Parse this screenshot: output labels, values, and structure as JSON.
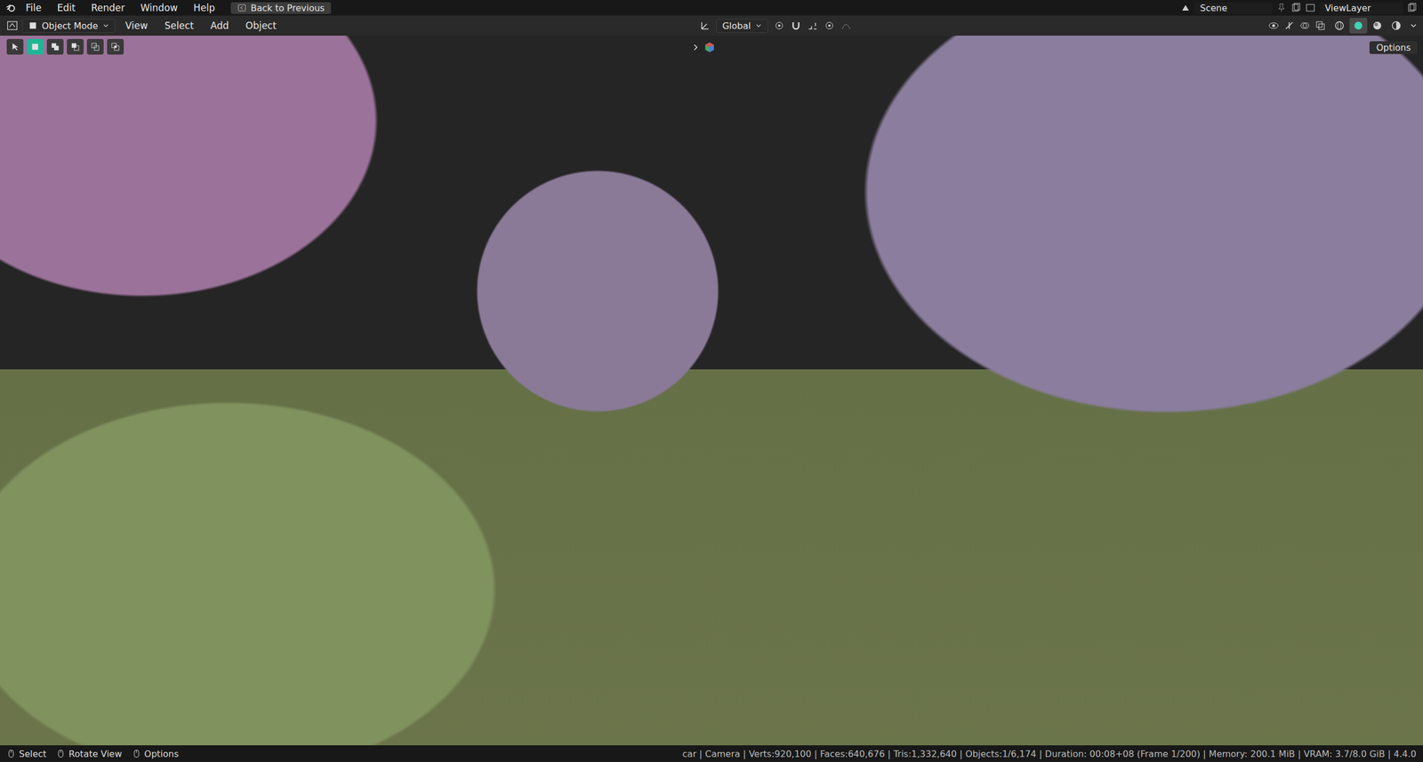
{
  "top_bar": {
    "menus": [
      "File",
      "Edit",
      "Render",
      "Window",
      "Help"
    ],
    "back_button": "Back to Previous",
    "scene": "Scene",
    "view_layer": "ViewLayer"
  },
  "header": {
    "mode": "Object Mode",
    "menus": [
      "View",
      "Select",
      "Add",
      "Object"
    ],
    "orientation": "Global",
    "shading": [
      {
        "kind": "wireframe",
        "selected": false
      },
      {
        "kind": "solid",
        "selected": true
      },
      {
        "kind": "material",
        "selected": false
      },
      {
        "kind": "rendered",
        "selected": false
      }
    ]
  },
  "tool_header": {
    "select_modes": [
      {
        "kind": "set",
        "selected": true
      },
      {
        "kind": "extend",
        "selected": false
      },
      {
        "kind": "subtract",
        "selected": false
      },
      {
        "kind": "difference",
        "selected": false
      },
      {
        "kind": "intersect",
        "selected": false
      }
    ],
    "options": "Options"
  },
  "status_bar": {
    "hints": [
      "Select",
      "Rotate View",
      "Options"
    ],
    "stats": "car | Camera | Verts:920,100 | Faces:640,676 | Tris:1,332,640 | Objects:1/6,174 | Duration: 00:08+08 (Frame 1/200) | Memory: 200.1 MiB | VRAM: 3.7/8.0 GiB | 4.4.0"
  }
}
